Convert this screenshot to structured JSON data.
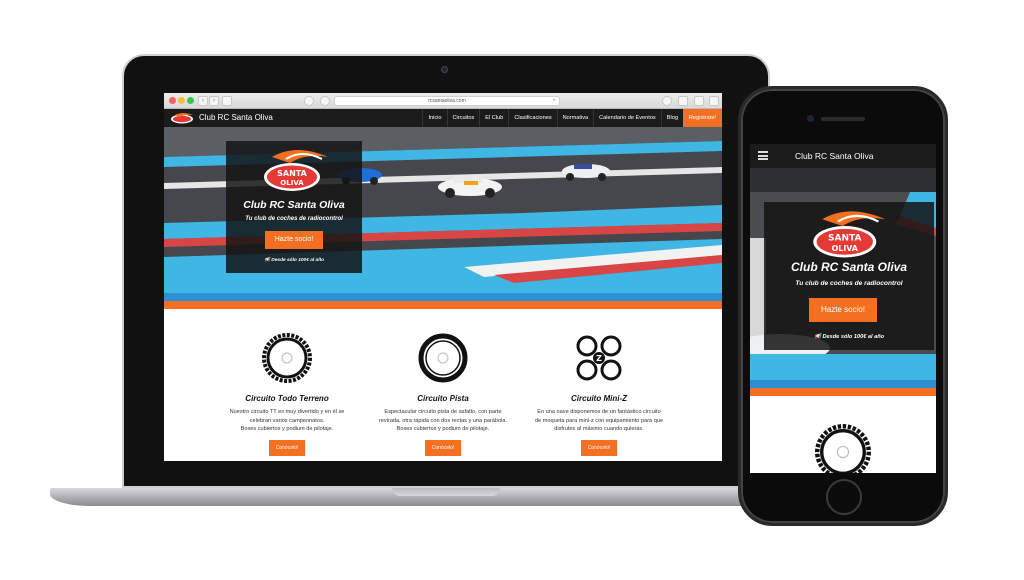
{
  "browser": {
    "url": "rcsantaoliva.com",
    "back_glyph": "‹",
    "forward_glyph": "›",
    "close_glyph": "×"
  },
  "site": {
    "brand": "Club RC Santa Oliva",
    "nav": [
      "Inicio",
      "Circuitos",
      "El Club",
      "Clasificaciones",
      "Normativa",
      "Calendario de Eventos",
      "Blog"
    ],
    "nav_cta": "Registrate!",
    "logo_text_top": "SANTA",
    "logo_text_bottom": "OLIVA",
    "hero": {
      "title": "Club RC Santa Oliva",
      "subtitle": "Tu club de coches de radiocontrol",
      "button": "Hazte socio!",
      "note": "Desde sólo 100€ al año"
    },
    "circuits": [
      {
        "title": "Circuito Todo Terreno",
        "desc": [
          "Nuestro circuito TT es muy divertido y en él se",
          "celebran varios campeonatos.",
          "Boxes cubiertos y podium de pilotaje."
        ],
        "button": "Conócelo!",
        "icon": "offroad-tire-icon"
      },
      {
        "title": "Circuito Pista",
        "desc": [
          "Espectacular circuito pista de asfalto, con parte",
          "revirada, otra rápida con dos rectas y una parábola.",
          "Boxes cubiertos y podium de pilotaje."
        ],
        "button": "Conócelo!",
        "icon": "track-tire-icon"
      },
      {
        "title": "Circuito Mini-Z",
        "desc": [
          "En una nave disponemos de un fantástico circuito",
          "de moqueta para mini-z con equipamiento para que",
          "disfrutes al máximo cuando quieras."
        ],
        "button": "Conócelo!",
        "icon": "mini-z-wheels-icon"
      }
    ]
  },
  "colors": {
    "accent": "#f36f21",
    "blue": "#2f8fd5",
    "dark": "#1b1b1b"
  }
}
